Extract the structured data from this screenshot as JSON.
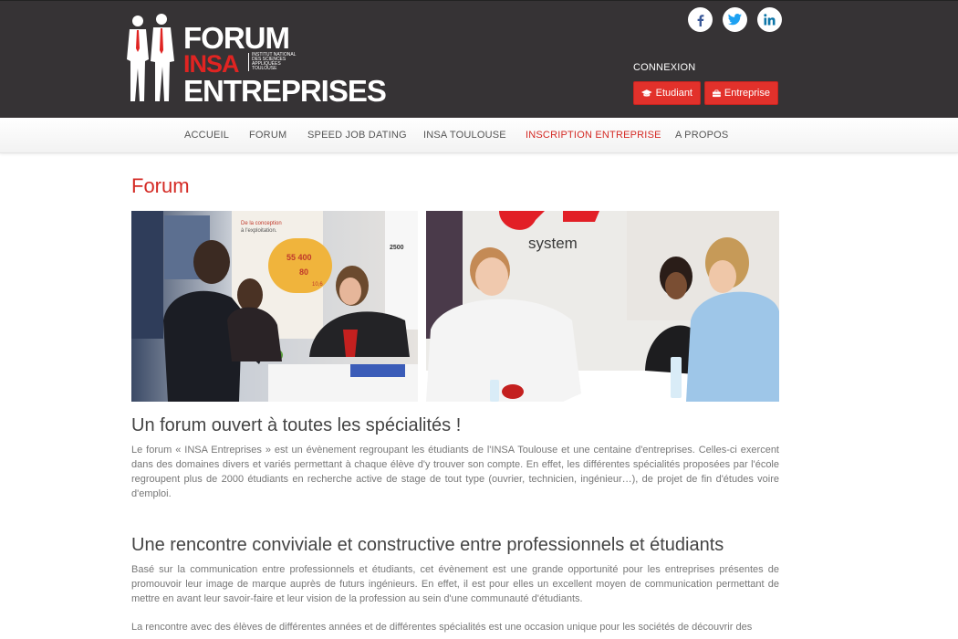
{
  "brand": {
    "line1": "FORUM",
    "line2": "INSA",
    "line3": "ENTREPRISES",
    "tagline": "INSTITUT NATIONAL DES SCIENCES APPLIQUÉES TOULOUSE"
  },
  "social": [
    "facebook-icon",
    "twitter-icon",
    "linkedin-icon"
  ],
  "auth": {
    "title": "CONNEXION",
    "student_label": "Etudiant",
    "company_label": "Entreprise"
  },
  "nav": {
    "items": [
      "ACCUEIL",
      "FORUM",
      "SPEED JOB DATING",
      "INSA TOULOUSE",
      "INSCRIPTION ENTREPRISE",
      "A PROPOS"
    ],
    "active": "INSCRIPTION ENTREPRISE"
  },
  "page": {
    "title": "Forum",
    "section1": {
      "heading": "Un forum ouvert à toutes les spécialités !",
      "body": "Le forum « INSA Entreprises » est un évènement regroupant les étudiants de l'INSA Toulouse et une centaine d'entreprises. Celles-ci exercent dans des domaines divers et variés permettant à chaque élève d'y trouver son compte. En effet, les différentes spécialités proposées par l'école regroupent plus de 2000 étudiants en recherche active de stage de tout type (ouvrier, technicien, ingénieur…), de projet de fin d'études voire d'emploi."
    },
    "section2": {
      "heading": "Une rencontre conviviale et constructive entre professionnels et étudiants",
      "body": "Basé sur la communication entre professionnels et étudiants, cet évènement est une grande opportunité pour les entreprises présentes de promouvoir leur image de marque auprès de futurs ingénieurs. En effet, il est pour elles un excellent moyen de communication permettant de mettre en avant leur savoir-faire et leur vision de la profession au sein d'une communauté d'étudiants.",
      "body2": "La rencontre avec des élèves de différentes années et de différentes spécialités est une occasion unique pour les sociétés de découvrir des"
    },
    "photo_signs": {
      "left_poster_line1": "De la conception",
      "left_poster_line2": "à l'exploitation.",
      "left_stat1": "55 400",
      "left_stat2": "80",
      "left_stat3": "10,6",
      "left_badge": "2500",
      "right_logo": "system"
    }
  },
  "colors": {
    "header_bg": "#363335",
    "accent": "#d42a24",
    "button": "#e2312b"
  }
}
